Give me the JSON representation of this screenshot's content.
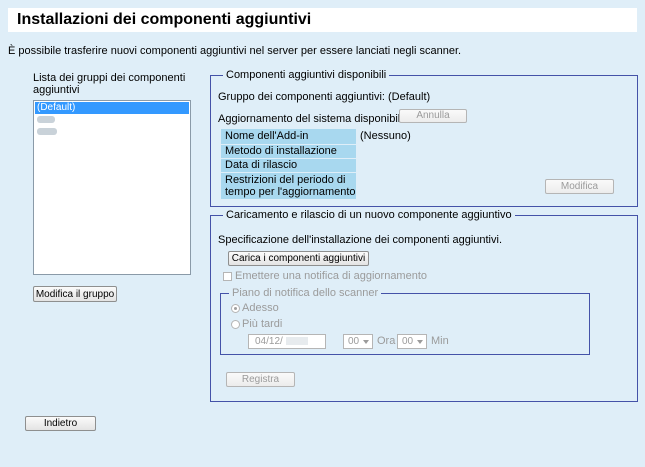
{
  "header": {
    "title": "Installazioni dei componenti aggiuntivi"
  },
  "intro": "È possibile trasferire nuovi componenti aggiuntivi nel server per essere lanciati negli scanner.",
  "group_list": {
    "label": "Lista dei gruppi dei componenti aggiuntivi",
    "items": [
      {
        "label": "(Default)",
        "selected": true
      },
      {
        "label": "",
        "selected": false
      },
      {
        "label": "",
        "selected": false
      }
    ],
    "edit_button": "Modifica il gruppo"
  },
  "available": {
    "legend": "Componenti aggiuntivi disponibili",
    "group_text": "Gruppo dei componenti aggiuntivi: (Default)",
    "update_label": "Aggiornamento del sistema disponibile",
    "cancel_button": "Annulla",
    "rows": [
      {
        "label": "Nome dell'Add-in",
        "value": "(Nessuno)"
      },
      {
        "label": "Metodo di installazione",
        "value": ""
      },
      {
        "label": "Data di rilascio",
        "value": ""
      },
      {
        "label": "Restrizioni del periodo di tempo per l'aggiornamento",
        "value": ""
      }
    ],
    "modify_button": "Modifica"
  },
  "upload": {
    "legend": "Caricamento e rilascio di un nuovo componente aggiuntivo",
    "spec_text": "Specificazione dell'installazione dei componenti aggiuntivi.",
    "load_button": "Carica i componenti aggiuntivi",
    "notify_checkbox": "Emettere una notifica di aggiornamento",
    "schedule": {
      "legend": "Piano di notifica dello scanner",
      "now": "Adesso",
      "later": "Più tardi",
      "date_value": "04/12/",
      "hour_value": "00",
      "hour_label": "Ora",
      "minute_value": "00",
      "minute_label": "Min"
    },
    "register_button": "Registra"
  },
  "back_button": "Indietro",
  "colors": {
    "frame_border": "#4452a8",
    "background": "#dfeef8",
    "cell_header": "#a8d8ef",
    "selection": "#3399ff"
  }
}
